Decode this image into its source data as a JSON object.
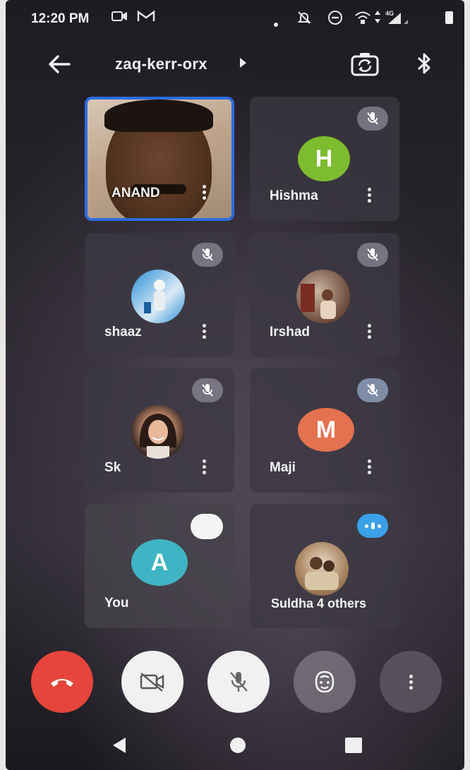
{
  "status_bar": {
    "time": "12:20 PM",
    "icons": [
      "video-icon",
      "gmail-icon",
      "dot-icon",
      "notifications-off-icon",
      "do-not-disturb-icon",
      "wifi-calling-icon",
      "data-arrows-icon",
      "signal-4g-icon",
      "battery-icon"
    ]
  },
  "header": {
    "meeting_code": "zaq-kerr-orx",
    "back_icon": "arrow-left-icon",
    "switch_camera_icon": "switch-camera-icon",
    "bluetooth_icon": "bluetooth-icon"
  },
  "participants": [
    {
      "name": "ANAND",
      "type": "video",
      "active": true
    },
    {
      "name": "Hishma",
      "type": "initial",
      "initial": "H",
      "color": "#7cbc2e",
      "muted": true
    },
    {
      "name": "shaaz",
      "type": "photo",
      "muted": true
    },
    {
      "name": "Irshad",
      "type": "photo",
      "muted": true
    },
    {
      "name": "Sk",
      "type": "photo",
      "muted": true
    },
    {
      "name": "Maji",
      "type": "initial",
      "initial": "M",
      "color": "#e4714f",
      "muted": true
    },
    {
      "name": "You",
      "type": "initial",
      "initial": "A",
      "color": "#3fb4c4"
    },
    {
      "name": "Suldha 4 others",
      "type": "photo",
      "speaking": true
    }
  ],
  "controls": {
    "end_call_icon": "call-end-icon",
    "camera_icon": "camera-off-icon",
    "mic_icon": "mic-off-icon",
    "effects_icon": "face-effects-icon",
    "more_icon": "more-vertical-icon"
  },
  "colors": {
    "active_border": "#2d6cdf",
    "end_call": "#e6453b",
    "speaking_badge": "#3aa0e8"
  }
}
